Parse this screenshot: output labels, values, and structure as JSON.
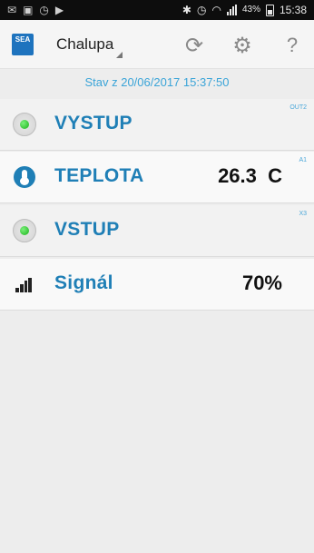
{
  "status_bar": {
    "time": "15:38",
    "battery": "43%"
  },
  "action_bar": {
    "title": "Chalupa",
    "logo_text": "SEA"
  },
  "timestamp": "Stav z 20/06/2017 15:37:50",
  "rows": [
    {
      "name": "VYSTUP",
      "value": "",
      "tag": "OUT2",
      "icon": "status-led-icon"
    },
    {
      "name": "TEPLOTA",
      "value": "26.3  C",
      "tag": "A1",
      "icon": "thermometer-icon"
    },
    {
      "name": "VSTUP",
      "value": "",
      "tag": "X3",
      "icon": "status-led-icon"
    },
    {
      "name": "Signál",
      "value": "70%",
      "tag": "",
      "icon": "signal-strength-icon"
    }
  ],
  "colors": {
    "accent": "#1f7fb6",
    "timestamp": "#3aa4d8",
    "led_on": "#19b319"
  }
}
